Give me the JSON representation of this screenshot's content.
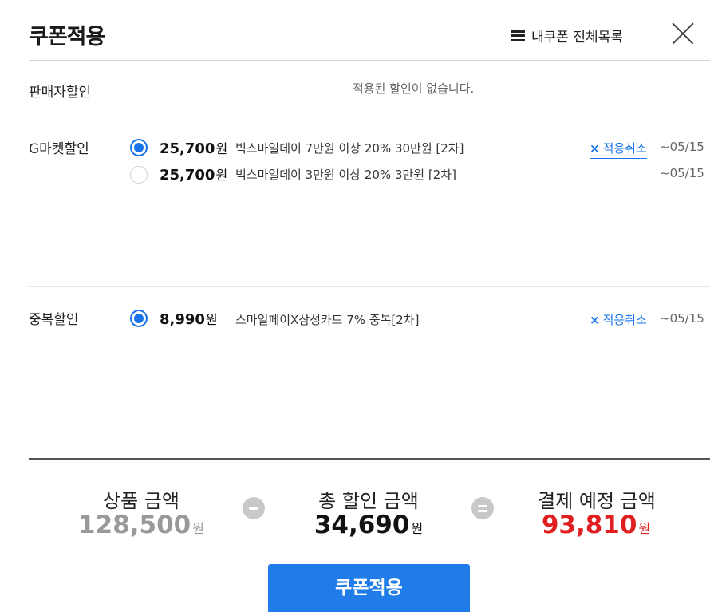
{
  "header": {
    "title": "쿠폰적용",
    "coupon_list_label": "내쿠폰 전체목록"
  },
  "seller": {
    "label": "판매자할인",
    "empty_text": "적용된 할인이 없습니다."
  },
  "gmarket": {
    "label": "G마켓할인",
    "coupons": [
      {
        "amount": "25,700",
        "won": "원",
        "desc": "빅스마일데이 7만원 이상 20% 30만원 [2차]",
        "selected": true,
        "cancel": "적용취소",
        "date": "~05/15"
      },
      {
        "amount": "25,700",
        "won": "원",
        "desc": "빅스마일데이 3만원 이상 20% 3만원 [2차]",
        "selected": false,
        "date": "~05/15"
      }
    ]
  },
  "duplicate": {
    "label": "중복할인",
    "coupons": [
      {
        "amount": "8,990",
        "won": "원",
        "desc": "스마일페이X삼성카드 7% 중복[2차]",
        "selected": true,
        "cancel": "적용취소",
        "date": "~05/15"
      }
    ]
  },
  "cancel_x": "×",
  "summary": {
    "product_label": "상품 금액",
    "product_value": "128,500",
    "discount_label": "총 할인 금액",
    "discount_value": "34,690",
    "payment_label": "결제 예정 금액",
    "payment_value": "93,810",
    "won": "원",
    "colors": {
      "product": "#999999",
      "discount": "#111111",
      "payment": "#e02020"
    }
  },
  "apply_button": "쿠폰적용"
}
